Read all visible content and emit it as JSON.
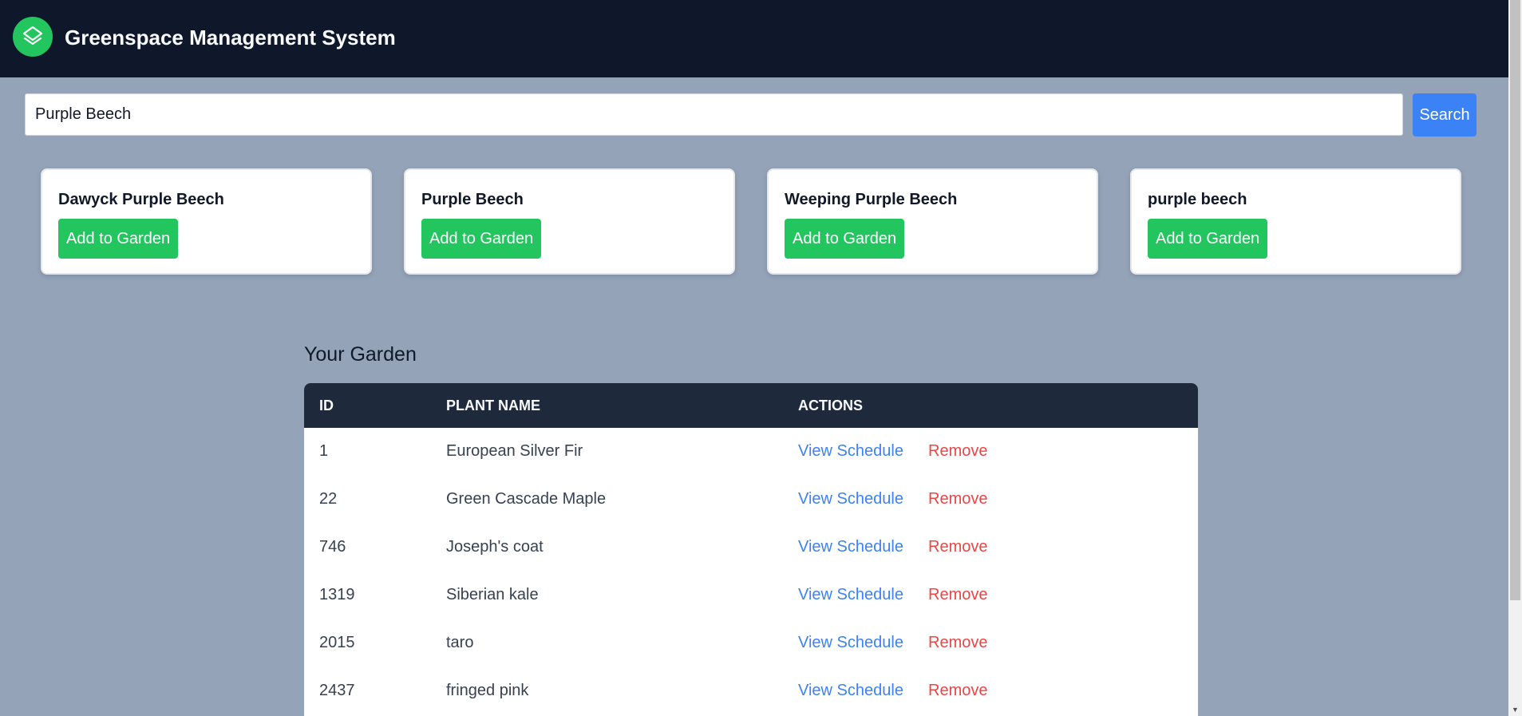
{
  "header": {
    "title": "Greenspace Management System",
    "logo_icon": "layers-icon",
    "bg_color": "#0f172a",
    "accent": "#22c55e"
  },
  "search": {
    "value": "Purple Beech",
    "placeholder": "",
    "button_label": "Search",
    "button_color": "#3b82f6"
  },
  "results": [
    {
      "name": "Dawyck Purple Beech",
      "button_label": "Add to Garden"
    },
    {
      "name": "Purple Beech",
      "button_label": "Add to Garden"
    },
    {
      "name": "Weeping Purple Beech",
      "button_label": "Add to Garden"
    },
    {
      "name": "purple beech",
      "button_label": "Add to Garden"
    }
  ],
  "garden": {
    "title": "Your Garden",
    "columns": [
      "ID",
      "PLANT NAME",
      "ACTIONS"
    ],
    "rows": [
      {
        "id": "1",
        "name": "European Silver Fir",
        "view": "View Schedule",
        "remove": "Remove"
      },
      {
        "id": "22",
        "name": "Green Cascade Maple",
        "view": "View Schedule",
        "remove": "Remove"
      },
      {
        "id": "746",
        "name": "Joseph's coat",
        "view": "View Schedule",
        "remove": "Remove"
      },
      {
        "id": "1319",
        "name": "Siberian kale",
        "view": "View Schedule",
        "remove": "Remove"
      },
      {
        "id": "2015",
        "name": "taro",
        "view": "View Schedule",
        "remove": "Remove"
      },
      {
        "id": "2437",
        "name": "fringed pink",
        "view": "View Schedule",
        "remove": "Remove"
      }
    ]
  }
}
